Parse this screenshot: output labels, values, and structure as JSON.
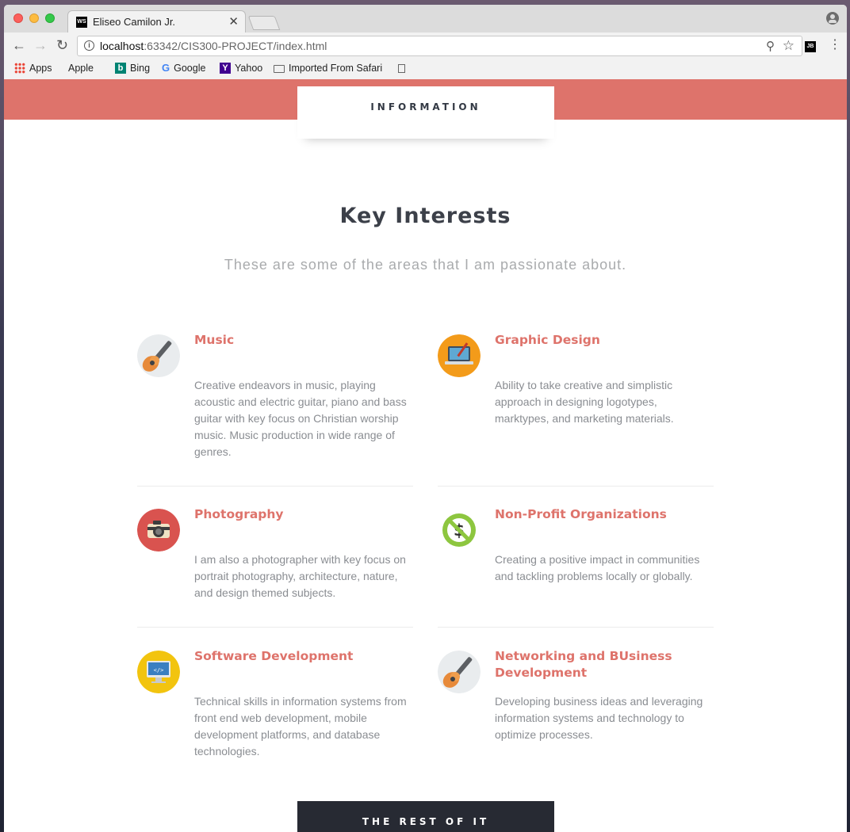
{
  "browser": {
    "tab_title": "Eliseo Camilon Jr.",
    "tab_favicon_text": "WS",
    "url_host": "localhost",
    "url_path": ":63342/CIS300-PROJECT/index.html",
    "extension_text": "JB",
    "bookmarks": [
      {
        "label": "Apps",
        "icon": "apps-grid-icon"
      },
      {
        "label": "Apple",
        "icon": "apple-icon"
      },
      {
        "label": "Bing",
        "icon": "bing-icon"
      },
      {
        "label": "Google",
        "icon": "google-icon"
      },
      {
        "label": "Yahoo",
        "icon": "yahoo-icon"
      },
      {
        "label": "Imported From Safari",
        "icon": "folder-icon"
      }
    ]
  },
  "page": {
    "section_tab": "INFORMATION",
    "heading": "Key Interests",
    "subheading": "These are some of the areas that I am passionate about.",
    "accent_color": "#de736b",
    "interests": [
      {
        "title": "Music",
        "icon": "guitar-icon",
        "text": "Creative endeavors in music, playing acoustic and electric guitar, piano and bass guitar with key focus on Christian worship music. Music production in wide range of genres."
      },
      {
        "title": "Graphic Design",
        "icon": "laptop-brush-icon",
        "text": "Ability to take creative and simplistic approach in designing logotypes, marktypes, and marketing materials."
      },
      {
        "title": "Photography",
        "icon": "camera-icon",
        "text": "I am also a photographer with key focus on portrait photography, architecture, nature, and design themed subjects."
      },
      {
        "title": "Non-Profit Organizations",
        "icon": "no-dollar-icon",
        "text": "Creating a positive impact in communities and tackling problems locally or globally."
      },
      {
        "title": "Software Development",
        "icon": "monitor-code-icon",
        "text": "Technical skills in information systems from front end web development, mobile development platforms, and database technologies."
      },
      {
        "title": "Networking and BUsiness Development",
        "icon": "guitar-icon",
        "text": "Developing business ideas and leveraging information systems and technology to optimize processes."
      }
    ],
    "bottom_tab": "THE REST OF IT"
  }
}
